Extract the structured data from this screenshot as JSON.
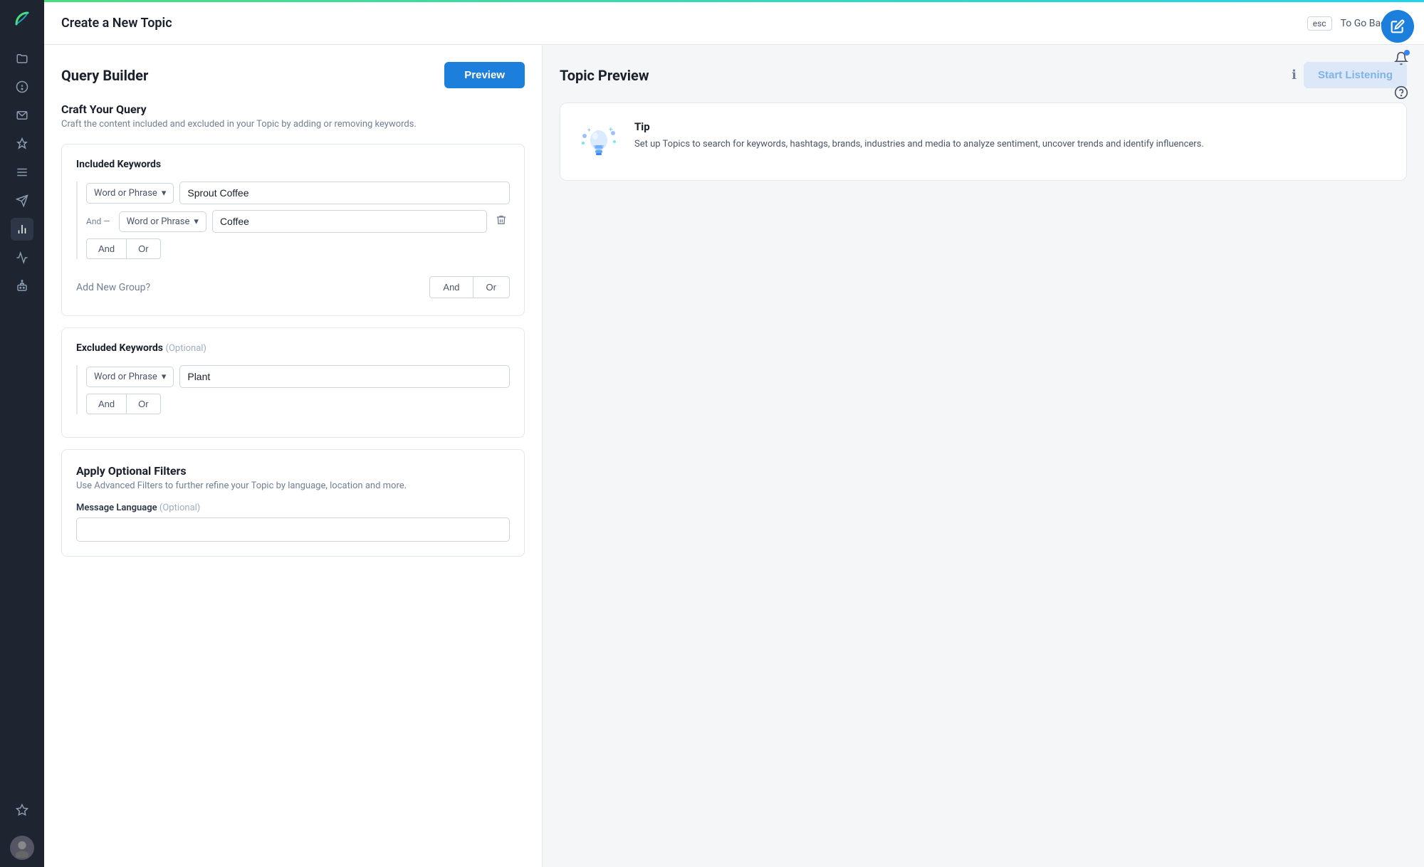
{
  "sidebar": {
    "logo_color": "#4ade80",
    "icons": [
      {
        "name": "folder-icon",
        "label": "Folder",
        "active": false
      },
      {
        "name": "alert-icon",
        "label": "Alerts",
        "active": false
      },
      {
        "name": "inbox-icon",
        "label": "Inbox",
        "active": false
      },
      {
        "name": "pin-icon",
        "label": "Pin",
        "active": false
      },
      {
        "name": "list-icon",
        "label": "List",
        "active": false
      },
      {
        "name": "send-icon",
        "label": "Send",
        "active": false
      },
      {
        "name": "analytics-icon",
        "label": "Analytics",
        "active": true
      },
      {
        "name": "bar-chart-icon",
        "label": "Bar Chart",
        "active": false
      },
      {
        "name": "robot-icon",
        "label": "Robot",
        "active": false
      },
      {
        "name": "star-icon",
        "label": "Star",
        "active": false
      }
    ]
  },
  "header": {
    "title": "Create a New Topic",
    "esc_label": "esc",
    "go_back_label": "To Go Back",
    "close_label": "×"
  },
  "left_panel": {
    "title": "Query Builder",
    "preview_button": "Preview",
    "craft_title": "Craft Your Query",
    "craft_desc": "Craft the content included and excluded in your Topic by adding or removing keywords.",
    "included_keywords": {
      "title": "Included Keywords",
      "group": {
        "keyword_type_1": "Word or Phrase",
        "keyword_value_1": "Sprout Coffee",
        "and_label": "And",
        "keyword_type_2": "Word or Phrase",
        "keyword_value_2": "Coffee",
        "and_btn": "And",
        "or_btn": "Or"
      },
      "add_new_group_text": "Add New Group?",
      "add_and_btn": "And",
      "add_or_btn": "Or"
    },
    "excluded_keywords": {
      "title": "Excluded Keywords",
      "optional_label": "(Optional)",
      "keyword_type_1": "Word or Phrase",
      "keyword_value_1": "Plant",
      "and_btn": "And",
      "or_btn": "Or"
    },
    "filters": {
      "title": "Apply Optional Filters",
      "desc": "Use Advanced Filters to further refine your Topic by language, location and more.",
      "language_label": "Message Language",
      "language_optional": "(Optional)",
      "language_placeholder": ""
    }
  },
  "right_panel": {
    "title": "Topic Preview",
    "start_listening_btn": "Start Listening",
    "info_icon": "ℹ",
    "tip": {
      "title": "Tip",
      "desc": "Set up Topics to search for keywords, hashtags, brands, industries and media to analyze sentiment, uncover trends and identify influencers."
    }
  },
  "top_right": {
    "edit_icon": "✎"
  }
}
